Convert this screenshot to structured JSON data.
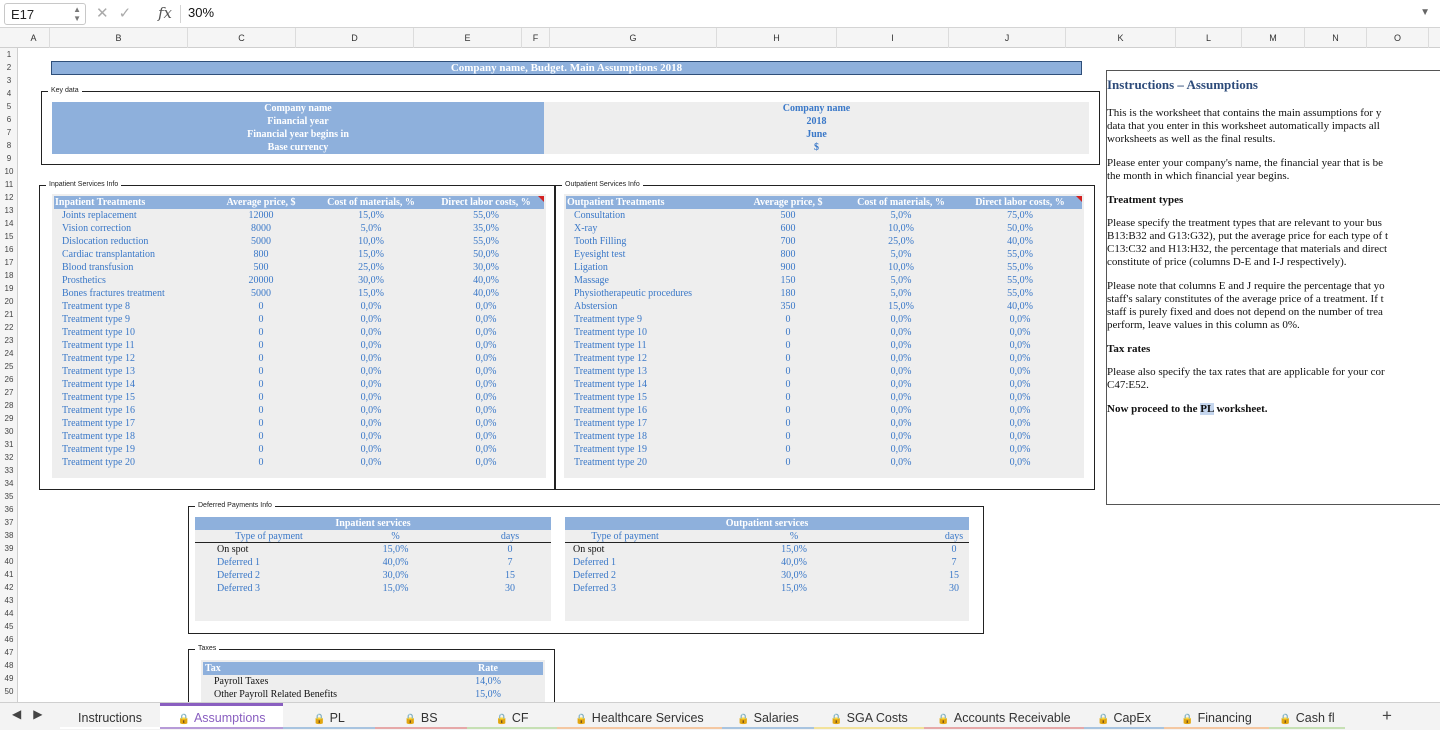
{
  "formula_bar": {
    "cell_ref": "E17",
    "cancel_icon": "✕",
    "confirm_icon": "✓",
    "fx": "fx",
    "value": "30%"
  },
  "columns": [
    "A",
    "B",
    "C",
    "D",
    "E",
    "F",
    "G",
    "H",
    "I",
    "J",
    "K",
    "L",
    "M",
    "N",
    "O"
  ],
  "rows": [
    "1",
    "2",
    "3",
    "4",
    "5",
    "6",
    "7",
    "8",
    "9",
    "10",
    "11",
    "12",
    "13",
    "14",
    "15",
    "16",
    "17",
    "18",
    "19",
    "20",
    "21",
    "22",
    "23",
    "24",
    "25",
    "26",
    "27",
    "28",
    "29",
    "30",
    "31",
    "32",
    "33",
    "34",
    "35",
    "36",
    "37",
    "38",
    "39",
    "40",
    "41",
    "42",
    "43",
    "44",
    "45",
    "46",
    "47",
    "48",
    "49",
    "50"
  ],
  "title": "Company name, Budget. Main Assumptions 2018",
  "key_data": {
    "label": "Key data",
    "labels": [
      "Company name",
      "Financial year",
      "Financial year begins in",
      "Base currency"
    ],
    "values": [
      "Company name",
      "2018",
      "June",
      "$"
    ]
  },
  "inpatient": {
    "label": "Inpatient Services Info",
    "headers": [
      "Inpatient Treatments",
      "Average price, $",
      "Cost of materials, %",
      "Direct labor costs, %"
    ],
    "rows": [
      [
        "Joints replacement",
        "12000",
        "15,0%",
        "55,0%"
      ],
      [
        "Vision correction",
        "8000",
        "5,0%",
        "35,0%"
      ],
      [
        "Dislocation reduction",
        "5000",
        "10,0%",
        "55,0%"
      ],
      [
        "Cardiac transplantation",
        "800",
        "15,0%",
        "50,0%"
      ],
      [
        "Blood transfusion",
        "500",
        "25,0%",
        "30,0%"
      ],
      [
        "Prosthetics",
        "20000",
        "30,0%",
        "40,0%"
      ],
      [
        "Bones fractures treatment",
        "5000",
        "15,0%",
        "40,0%"
      ],
      [
        "Treatment type 8",
        "0",
        "0,0%",
        "0,0%"
      ],
      [
        "Treatment type 9",
        "0",
        "0,0%",
        "0,0%"
      ],
      [
        "Treatment type 10",
        "0",
        "0,0%",
        "0,0%"
      ],
      [
        "Treatment type 11",
        "0",
        "0,0%",
        "0,0%"
      ],
      [
        "Treatment type 12",
        "0",
        "0,0%",
        "0,0%"
      ],
      [
        "Treatment type 13",
        "0",
        "0,0%",
        "0,0%"
      ],
      [
        "Treatment type 14",
        "0",
        "0,0%",
        "0,0%"
      ],
      [
        "Treatment type 15",
        "0",
        "0,0%",
        "0,0%"
      ],
      [
        "Treatment type 16",
        "0",
        "0,0%",
        "0,0%"
      ],
      [
        "Treatment type 17",
        "0",
        "0,0%",
        "0,0%"
      ],
      [
        "Treatment type 18",
        "0",
        "0,0%",
        "0,0%"
      ],
      [
        "Treatment type 19",
        "0",
        "0,0%",
        "0,0%"
      ],
      [
        "Treatment type 20",
        "0",
        "0,0%",
        "0,0%"
      ]
    ]
  },
  "outpatient": {
    "label": "Outpatient Services Info",
    "headers": [
      "Outpatient Treatments",
      "Average price, $",
      "Cost of materials, %",
      "Direct labor costs, %"
    ],
    "rows": [
      [
        "Consultation",
        "500",
        "5,0%",
        "75,0%"
      ],
      [
        "X-ray",
        "600",
        "10,0%",
        "50,0%"
      ],
      [
        "Tooth Filling",
        "700",
        "25,0%",
        "40,0%"
      ],
      [
        "Eyesight test",
        "800",
        "5,0%",
        "55,0%"
      ],
      [
        "Ligation",
        "900",
        "10,0%",
        "55,0%"
      ],
      [
        "Massage",
        "150",
        "5,0%",
        "55,0%"
      ],
      [
        "Physiotherapeutic procedures",
        "180",
        "5,0%",
        "55,0%"
      ],
      [
        "Abstersion",
        "350",
        "15,0%",
        "40,0%"
      ],
      [
        "Treatment type 9",
        "0",
        "0,0%",
        "0,0%"
      ],
      [
        "Treatment type 10",
        "0",
        "0,0%",
        "0,0%"
      ],
      [
        "Treatment type 11",
        "0",
        "0,0%",
        "0,0%"
      ],
      [
        "Treatment type 12",
        "0",
        "0,0%",
        "0,0%"
      ],
      [
        "Treatment type 13",
        "0",
        "0,0%",
        "0,0%"
      ],
      [
        "Treatment type 14",
        "0",
        "0,0%",
        "0,0%"
      ],
      [
        "Treatment type 15",
        "0",
        "0,0%",
        "0,0%"
      ],
      [
        "Treatment type 16",
        "0",
        "0,0%",
        "0,0%"
      ],
      [
        "Treatment type 17",
        "0",
        "0,0%",
        "0,0%"
      ],
      [
        "Treatment type 18",
        "0",
        "0,0%",
        "0,0%"
      ],
      [
        "Treatment type 19",
        "0",
        "0,0%",
        "0,0%"
      ],
      [
        "Treatment type 20",
        "0",
        "0,0%",
        "0,0%"
      ]
    ]
  },
  "deferred": {
    "label": "Deferred Payments Info",
    "inpatient_title": "Inpatient services",
    "outpatient_title": "Outpatient services",
    "headers": [
      "Type of payment",
      "%",
      "days"
    ],
    "rows": [
      [
        "On spot",
        "15,0%",
        "0"
      ],
      [
        "Deferred 1",
        "40,0%",
        "7"
      ],
      [
        "Deferred 2",
        "30,0%",
        "15"
      ],
      [
        "Deferred 3",
        "15,0%",
        "30"
      ]
    ]
  },
  "taxes": {
    "label": "Taxes",
    "headers": [
      "Tax",
      "Rate"
    ],
    "rows": [
      [
        "Payroll Taxes",
        "14,0%"
      ],
      [
        "Other Payroll Related Benefits",
        "15,0%"
      ]
    ]
  },
  "instructions": {
    "title": "Instructions – Assumptions",
    "p1": [
      "This is the worksheet that contains the main assumptions for y",
      "data that you enter in this worksheet automatically impacts all",
      "worksheets as well as the final results."
    ],
    "p2": [
      "Please enter your company's name, the financial year that is be",
      "the month in which financial year begins."
    ],
    "h_treat": "Treatment types",
    "p3": [
      "Please specify the treatment types that are relevant to your bus",
      "B13:B32 and G13:G32), put the average price for each type of t",
      "C13:C32 and H13:H32, the percentage that materials and direct",
      "constitute of price (columns D-E and I-J respectively)."
    ],
    "p4": [
      "Please note that columns E and J require the percentage that yo",
      "staff's salary constitutes of the average price of a treatment. If t",
      "staff is purely fixed and does not depend on the number of trea",
      "perform, leave values in this column as 0%."
    ],
    "h_tax": "Tax rates",
    "p5": [
      "Please also specify the tax rates that are applicable for your cor",
      "C47:E52."
    ],
    "p6_pre": "Now proceed to the ",
    "p6_hl": "PL",
    "p6_post": " worksheet."
  },
  "tabs": [
    {
      "label": "Instructions",
      "lock": false,
      "color": "#ffffff"
    },
    {
      "label": "Assumptions",
      "lock": true,
      "color": "#b79bd8"
    },
    {
      "label": "PL",
      "lock": true,
      "color": "#a8c4e0"
    },
    {
      "label": "BS",
      "lock": true,
      "color": "#e6a8a8"
    },
    {
      "label": "CF",
      "lock": true,
      "color": "#c6e0b4"
    },
    {
      "label": "Healthcare Services",
      "lock": true,
      "color": "#f4c7a1"
    },
    {
      "label": "Salaries",
      "lock": true,
      "color": "#a8c4e0"
    },
    {
      "label": "SGA Costs",
      "lock": true,
      "color": "#f2e29a"
    },
    {
      "label": "Accounts Receivable",
      "lock": true,
      "color": "#e6a8a8"
    },
    {
      "label": "CapEx",
      "lock": true,
      "color": "#a8c4e0"
    },
    {
      "label": "Financing",
      "lock": true,
      "color": "#f4c7a1"
    },
    {
      "label": "Cash fl",
      "lock": true,
      "color": "#c6e0b4"
    }
  ],
  "icons": {
    "lock": "🔒",
    "prev": "◀",
    "next": "▶",
    "add": "+"
  }
}
